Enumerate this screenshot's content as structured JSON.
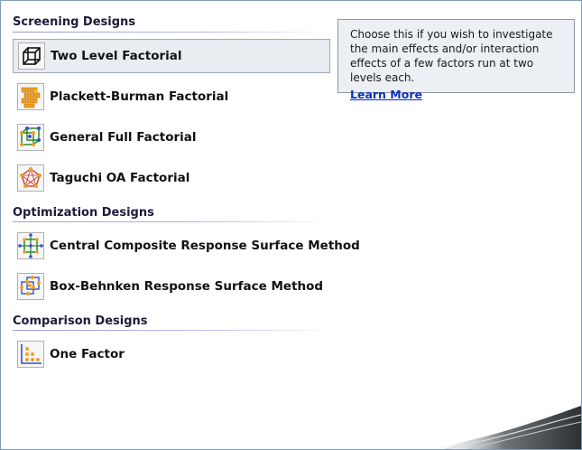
{
  "sections": [
    {
      "key": "screening",
      "title": "Screening Designs"
    },
    {
      "key": "optimization",
      "title": "Optimization Designs"
    },
    {
      "key": "comparison",
      "title": "Comparison Designs"
    }
  ],
  "items": [
    {
      "label": "Two Level Factorial",
      "icon": "two-level-factorial-icon",
      "selected": true
    },
    {
      "label": "Plackett-Burman Factorial",
      "icon": "plackett-burman-icon"
    },
    {
      "label": "General Full Factorial",
      "icon": "general-full-factorial-icon"
    },
    {
      "label": "Taguchi OA Factorial",
      "icon": "taguchi-icon"
    },
    {
      "label": "Central Composite Response Surface Method",
      "icon": "central-composite-icon"
    },
    {
      "label": "Box-Behnken Response Surface Method",
      "icon": "box-behnken-icon"
    },
    {
      "label": "One Factor",
      "icon": "one-factor-icon"
    }
  ],
  "tooltip": {
    "text": "Choose this if you wish to investigate the main effects and/or interaction effects of a few factors run at two levels each.",
    "link": "Learn More"
  },
  "colors": {
    "accent_link": "#0a2fbf",
    "selected_bg": "#e9ecf0",
    "tooltip_bg": "#eceff3"
  }
}
